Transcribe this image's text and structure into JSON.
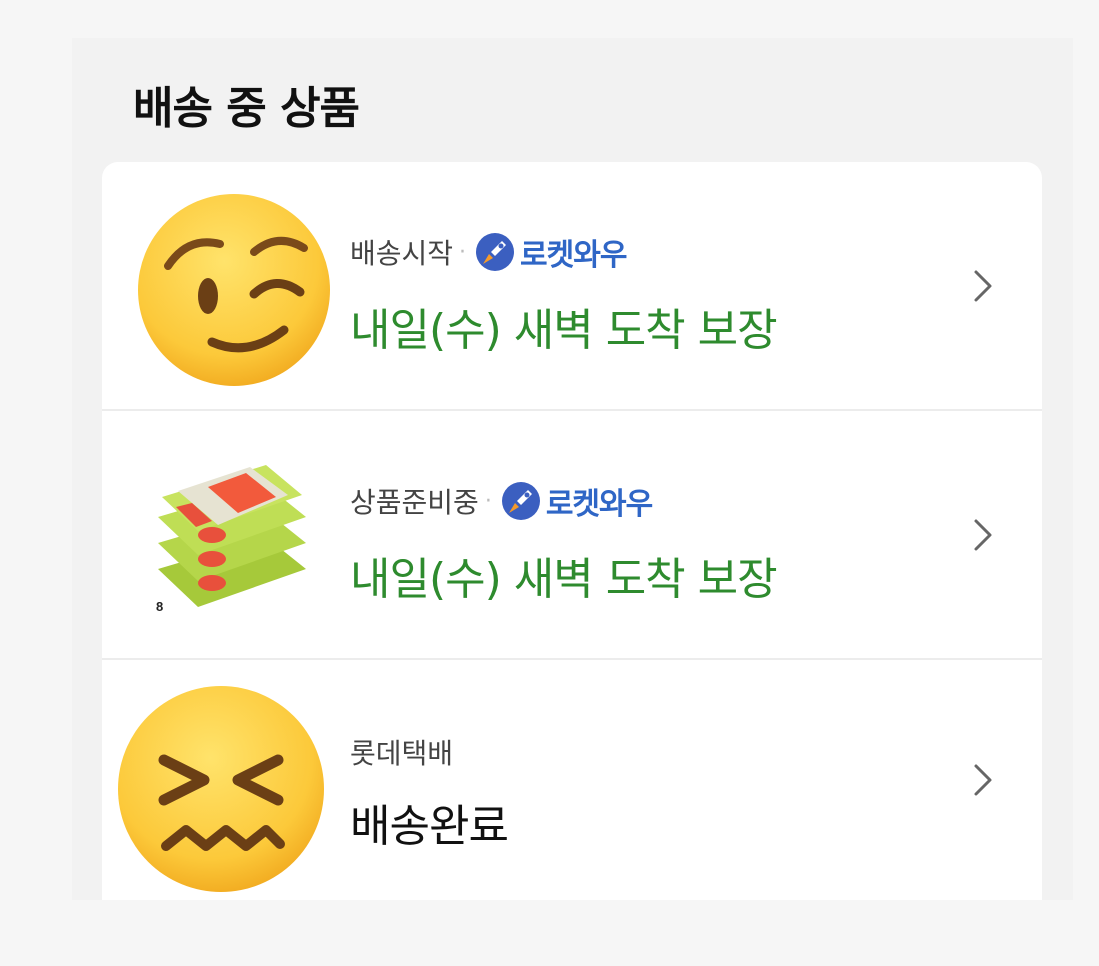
{
  "section": {
    "title": "배송 중 상품"
  },
  "colors": {
    "accent_green": "#2e8b2e",
    "rocket_blue": "#2f66c6",
    "text_dark": "#111111"
  },
  "shipments": [
    {
      "thumbnail_icon": "winking-face-emoji",
      "carrier_status": "배송시작",
      "badge": "로켓와우",
      "status": "내일(수) 새벽 도착 보장"
    },
    {
      "thumbnail_icon": "wet-wipes-package",
      "carrier_status": "상품준비중",
      "badge": "로켓와우",
      "package_count": "8",
      "status": "내일(수) 새벽 도착 보장"
    },
    {
      "thumbnail_icon": "confounded-face-emoji",
      "carrier_status": "롯데택배",
      "status": "배송완료"
    }
  ]
}
